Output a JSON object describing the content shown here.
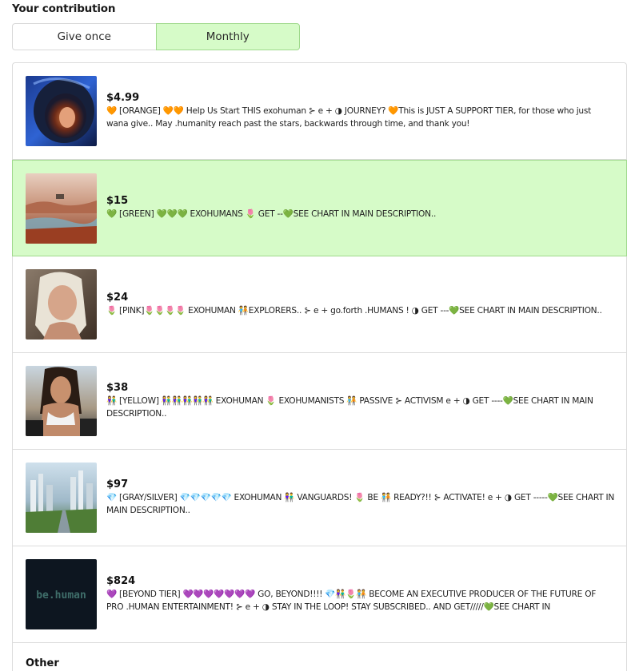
{
  "contribution": {
    "title": "Your contribution"
  },
  "frequency": {
    "give_once": "Give once",
    "monthly": "Monthly",
    "selected": "Monthly"
  },
  "tiers": [
    {
      "price": "$4.99",
      "description": "🧡 [ORANGE] 🧡🧡 Help Us Start THIS exohuman ⊱ e + ◑ JOURNEY? 🧡This is JUST A SUPPORT TIER, for those who just wana give.. May .humanity reach past the stars, backwards through time, and thank you!",
      "image": "astronaut-portrait"
    },
    {
      "price": "$15",
      "description": "💚 [GREEN] 💚💚💚 EXOHUMANS 🌷 GET --💚SEE CHART IN MAIN DESCRIPTION..",
      "image": "desert-landscape"
    },
    {
      "price": "$24",
      "description": "🌷 [PINK]🌷🌷🌷🌷 EXOHUMAN 🧑‍🤝‍🧑EXPLORERS.. ⊱ e + go.forth .HUMANS ! ◑ GET ---💚SEE CHART IN MAIN DESCRIPTION..",
      "image": "woman-portrait-blonde"
    },
    {
      "price": "$38",
      "description": "👫 [YELLOW] 👫👫👫👫👫 EXOHUMAN 🌷 EXOHUMANISTS 🧑‍🤝‍🧑 PASSIVE ⊱ ACTIVISM e + ◑ GET ----💚SEE CHART IN MAIN DESCRIPTION..",
      "image": "woman-portrait-dark"
    },
    {
      "price": "$97",
      "description": "💎 [GRAY/SILVER] 💎💎💎💎💎 EXOHUMAN 👫 VANGUARDS! 🌷 BE 🧑‍🤝‍🧑 READY?!! ⊱ ACTIVATE! e + ◑ GET -----💚SEE CHART IN MAIN DESCRIPTION..",
      "image": "future-city"
    },
    {
      "price": "$824",
      "description": "💜 [BEYOND TIER] 💜💜💜💜💜💜💜 GO, BEYOND!!!! 💎👫🌷🧑‍🤝‍🧑 BECOME AN EXECUTIVE PRODUCER OF THE FUTURE OF PRO .HUMAN ENTERTAINMENT! ⊱ e + ◑ STAY IN THE LOOP! STAY SUBSCRIBED.. AND GET/////💚SEE CHART IN",
      "image": "be-human-logo",
      "logo_text": "be.human"
    }
  ],
  "selected_tier": "$15",
  "other": {
    "label": "Other"
  },
  "colors": {
    "selected_bg": "#d6fbc8",
    "selected_border": "#9fd98c"
  }
}
